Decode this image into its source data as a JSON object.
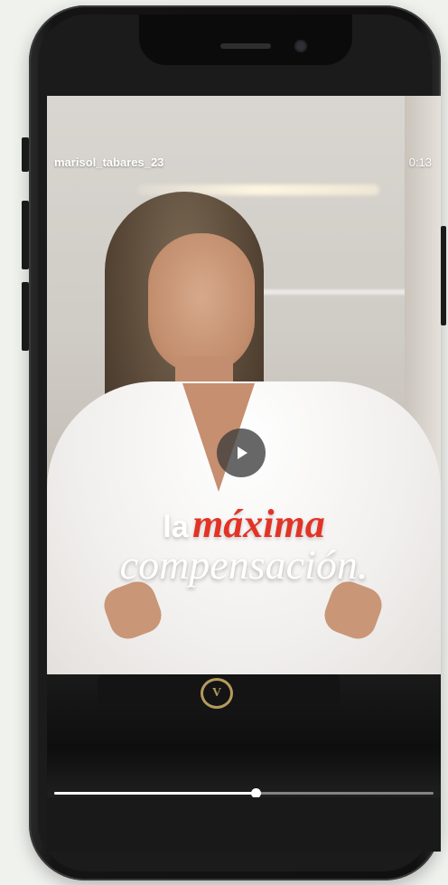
{
  "video": {
    "username": "marisol_tabares_23",
    "timestamp": "0:13",
    "caption_line1_a": "la",
    "caption_line1_b": "máxima",
    "caption_line2": "compensación.",
    "buckle_glyph": "V",
    "progress": 0.53
  },
  "icons": {
    "play": "play-icon"
  },
  "colors": {
    "accent": "#e23326",
    "phone_frame": "#141414",
    "buckle_gold": "#b59a5e"
  }
}
